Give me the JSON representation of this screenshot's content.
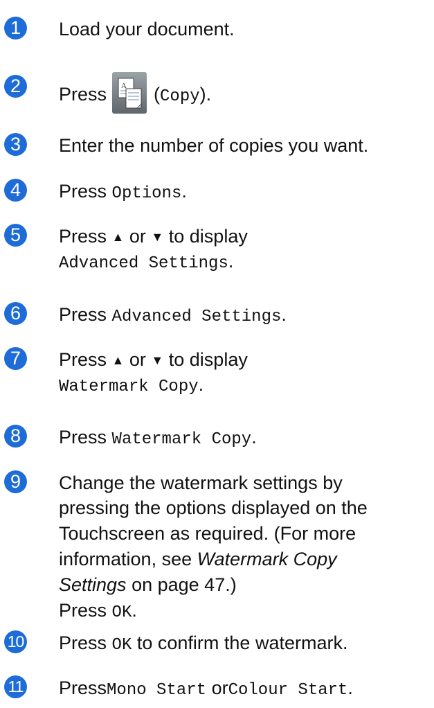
{
  "steps": [
    {
      "n": "1",
      "text": "Load your document."
    },
    {
      "n": "2",
      "press": "Press",
      "copy_label": "Copy",
      "open": "(",
      "close": ")."
    },
    {
      "n": "3",
      "text": "Enter the number of copies you want."
    },
    {
      "n": "4",
      "press": "Press",
      "mono": "Options",
      "end": "."
    },
    {
      "n": "5",
      "line1": "Press",
      "up": "▲",
      "or": "or",
      "down": "▼",
      "to": "to display",
      "mono": "Advanced Settings",
      "end": "."
    },
    {
      "n": "6",
      "press": "Press",
      "mono": "Advanced Settings",
      "end": "."
    },
    {
      "n": "7",
      "line1": "Press",
      "up": "▲",
      "or": "or",
      "down": "▼",
      "to": "to display",
      "mono": "Watermark Copy",
      "end": "."
    },
    {
      "n": "8",
      "press": "Press",
      "mono": "Watermark Copy",
      "end": "."
    },
    {
      "n": "9",
      "l1": "Change the watermark settings by",
      "l2": "pressing the options displayed on the",
      "l3": "Touchscreen as required. (For more",
      "l4a": "information, see",
      "l4b": "Watermark Copy",
      "l5a": "Settings",
      "l5b": "on page 47.)",
      "l6a": "Press",
      "l6b": "OK",
      "l6c": "."
    },
    {
      "n": "10",
      "press": "Press",
      "mono": "OK",
      "rest": "to confirm the watermark."
    },
    {
      "n": "11",
      "press": "Press",
      "mono1": "Mono Start",
      "or": "or",
      "mono2": "Colour Start",
      "end": "."
    }
  ],
  "icons": {
    "copy": "copy-icon"
  },
  "colors": {
    "step_badge": "#1d6cd8"
  }
}
